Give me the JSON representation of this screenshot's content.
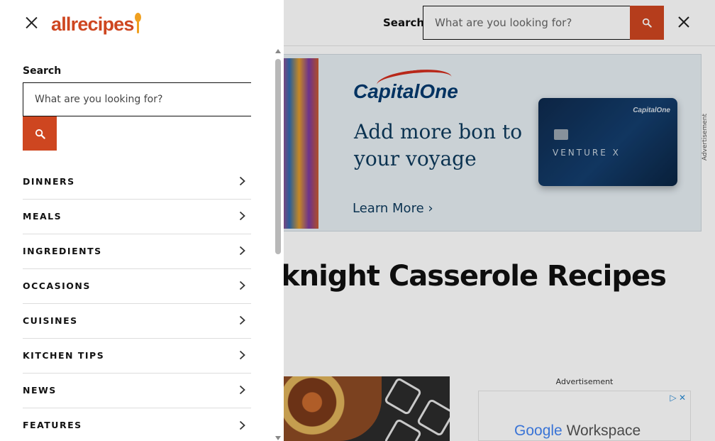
{
  "header": {
    "search_label": "Search",
    "search_placeholder": "What are you looking for?",
    "search_icon": "search-icon",
    "close_icon": "close-icon"
  },
  "ad_banner": {
    "brand": "CapitalOne",
    "headline": "Add more bon to your voyage",
    "cta": "Learn More ›",
    "card_brand": "CapitalOne",
    "card_name": "VENTURE X",
    "side_label": "Advertisement"
  },
  "page": {
    "title": "knight Casserole Recipes"
  },
  "side_ad": {
    "label": "Advertisement",
    "brand_google": "Google",
    "brand_product": "Workspace",
    "controls": "▷ ✕"
  },
  "drawer": {
    "logo": "allrecipes",
    "close_icon": "close-icon",
    "search_label": "Search",
    "search_placeholder": "What are you looking for?",
    "search_icon": "search-icon",
    "nav_items": [
      {
        "label": "DINNERS"
      },
      {
        "label": "MEALS"
      },
      {
        "label": "INGREDIENTS"
      },
      {
        "label": "OCCASIONS"
      },
      {
        "label": "CUISINES"
      },
      {
        "label": "KITCHEN TIPS"
      },
      {
        "label": "NEWS"
      },
      {
        "label": "FEATURES"
      }
    ]
  },
  "colors": {
    "brand": "#ce4620",
    "logo_spoon": "#f0a020"
  }
}
